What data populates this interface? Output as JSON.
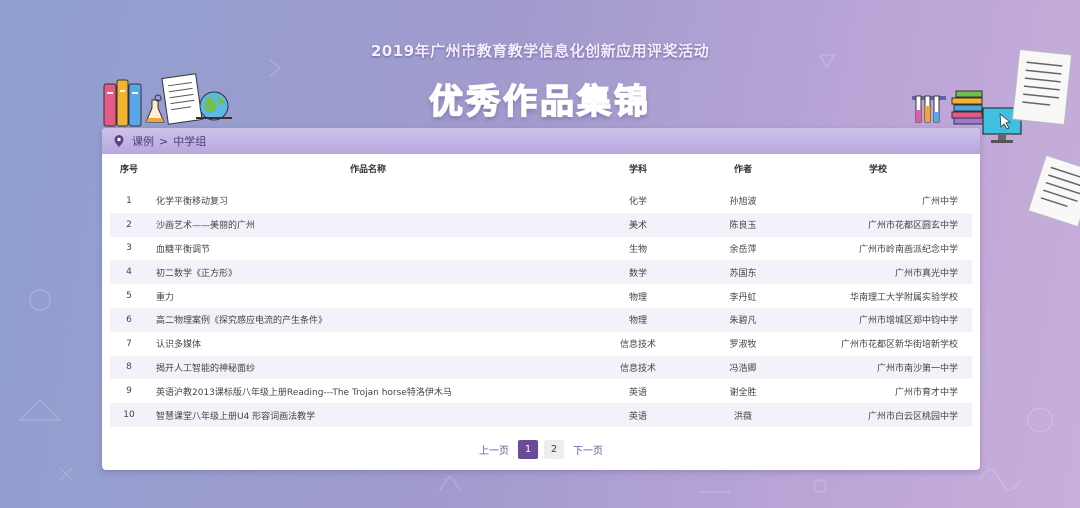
{
  "header": {
    "subtitle": "2019年广州市教育教学信息化创新应用评奖活动",
    "title_chars": [
      "优",
      "秀",
      "作",
      "品",
      "集",
      "锦"
    ]
  },
  "breadcrumb": {
    "root": "课例",
    "separator": ">",
    "current": "中学组"
  },
  "table": {
    "headers": {
      "num": "序号",
      "name": "作品名称",
      "subject": "学科",
      "author": "作者",
      "school": "学校"
    },
    "rows": [
      {
        "num": "1",
        "name": "化学平衡移动复习",
        "subject": "化学",
        "author": "孙旭波",
        "school": "广州中学"
      },
      {
        "num": "2",
        "name": "沙画艺术——美丽的广州",
        "subject": "美术",
        "author": "陈良玉",
        "school": "广州市花都区圆玄中学"
      },
      {
        "num": "3",
        "name": "血糖平衡调节",
        "subject": "生物",
        "author": "余岳萍",
        "school": "广州市岭南画派纪念中学"
      },
      {
        "num": "4",
        "name": "初二数学《正方形》",
        "subject": "数学",
        "author": "苏国东",
        "school": "广州市真光中学"
      },
      {
        "num": "5",
        "name": "重力",
        "subject": "物理",
        "author": "李丹虹",
        "school": "华南理工大学附属实验学校"
      },
      {
        "num": "6",
        "name": "高二物理案例《探究感应电流的产生条件》",
        "subject": "物理",
        "author": "朱碧凡",
        "school": "广州市增城区郑中钧中学"
      },
      {
        "num": "7",
        "name": "认识多媒体",
        "subject": "信息技术",
        "author": "罗淑牧",
        "school": "广州市花都区新华街培新学校"
      },
      {
        "num": "8",
        "name": "揭开人工智能的神秘面纱",
        "subject": "信息技术",
        "author": "冯浩卿",
        "school": "广州市南沙第一中学"
      },
      {
        "num": "9",
        "name": "英语沪教2013课标版八年级上册Reading---The Trojan horse特洛伊木马",
        "subject": "英语",
        "author": "谢全胜",
        "school": "广州市育才中学"
      },
      {
        "num": "10",
        "name": "智慧课堂八年级上册U4 形容词画法教学",
        "subject": "英语",
        "author": "洪薇",
        "school": "广州市白云区桃园中学"
      }
    ]
  },
  "pagination": {
    "prev": "上一页",
    "pages": [
      "1",
      "2"
    ],
    "current": "1",
    "next": "下一页"
  },
  "colors": {
    "accent": "#6b4b95",
    "crumb_bar": "#c2b4e4"
  }
}
